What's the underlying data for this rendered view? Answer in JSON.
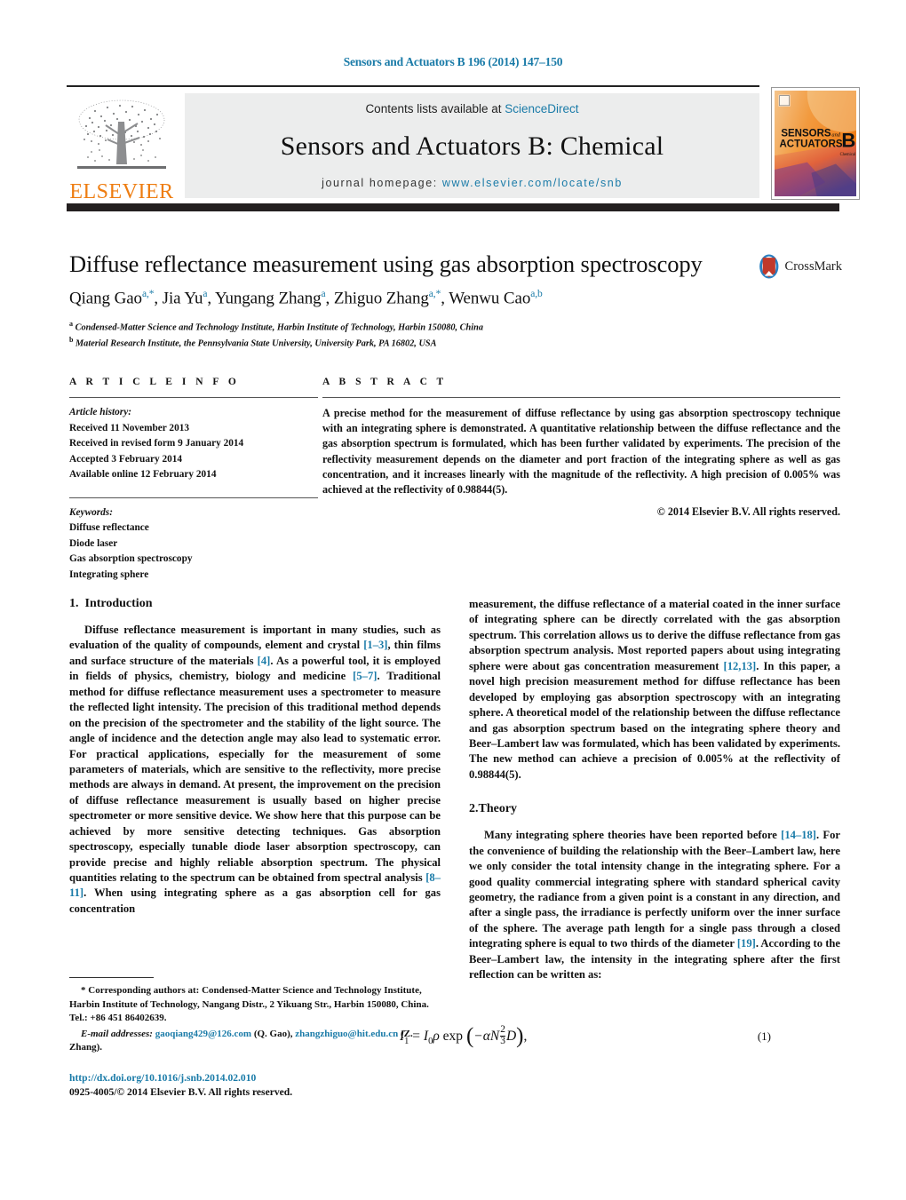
{
  "running_head": "Sensors and Actuators B 196 (2014) 147–150",
  "masthead": {
    "contents_prefix": "Contents lists available at ",
    "sciencedirect": "ScienceDirect",
    "journal_title": "Sensors and Actuators B: Chemical",
    "homepage_prefix": "journal homepage: ",
    "homepage_url": "www.elsevier.com/locate/snb",
    "publisher_wordmark": "ELSEVIER",
    "cover_line1": "SENSORS",
    "cover_and": "and",
    "cover_line2": "ACTUATORS",
    "cover_letter": "B",
    "cover_sub": "Chemical"
  },
  "article": {
    "title": "Diffuse reflectance measurement using gas absorption spectroscopy",
    "crossmark_label": "CrossMark",
    "authors_html": "Qiang Gao<sup>a,*</sup>, Jia Yu<sup>a</sup>, Yungang Zhang<sup>a</sup>, Zhiguo Zhang<sup>a,*</sup>, Wenwu Cao<sup>a,b</sup>",
    "affiliations": [
      "a Condensed-Matter Science and Technology Institute, Harbin Institute of Technology, Harbin 150080, China",
      "b Material Research Institute, the Pennsylvania State University, University Park, PA 16802, USA"
    ]
  },
  "article_info": {
    "heading": "A R T I C L E    I N F O",
    "history_label": "Article history:",
    "history": [
      "Received 11 November 2013",
      "Received in revised form 9 January 2014",
      "Accepted 3 February 2014",
      "Available online 12 February 2014"
    ],
    "keywords_label": "Keywords:",
    "keywords": [
      "Diffuse reflectance",
      "Diode laser",
      "Gas absorption spectroscopy",
      "Integrating sphere"
    ]
  },
  "abstract": {
    "heading": "A B S T R A C T",
    "text": "A precise method for the measurement of diffuse reflectance by using gas absorption spectroscopy technique with an integrating sphere is demonstrated. A quantitative relationship between the diffuse reflectance and the gas absorption spectrum is formulated, which has been further validated by experiments. The precision of the reflectivity measurement depends on the diameter and port fraction of the integrating sphere as well as gas concentration, and it increases linearly with the magnitude of the reflectivity. A high precision of 0.005% was achieved at the reflectivity of 0.98844(5).",
    "copyright": "© 2014 Elsevier B.V. All rights reserved."
  },
  "sections": {
    "intro": {
      "number": "1.",
      "title": "Introduction",
      "para_part1": "Diffuse reflectance measurement is important in many studies, such as evaluation of the quality of compounds, element and crystal ",
      "ref1": "[1–3]",
      "para_part2": ", thin films and surface structure of the materials ",
      "ref2": "[4]",
      "para_part3": ". As a powerful tool, it is employed in fields of physics, chemistry, biology and medicine ",
      "ref3": "[5–7]",
      "para_part4": ". Traditional method for diffuse reflectance measurement uses a spectrometer to measure the reflected light intensity. The precision of this traditional method depends on the precision of the spectrometer and the stability of the light source. The angle of incidence and the detection angle may also lead to systematic error. For practical applications, especially for the measurement of some parameters of materials, which are sensitive to the reflectivity, more precise methods are always in demand. At present, the improvement on the precision of diffuse reflectance measurement is usually based on higher precise spectrometer or more sensitive device. We show here that this purpose can be achieved by more sensitive detecting techniques. Gas absorption spectroscopy, especially tunable diode laser absorption spectroscopy, can provide precise and highly reliable absorption spectrum. The physical quantities relating to the spectrum can be obtained from spectral analysis ",
      "ref4": "[8–11]",
      "para_part5": ". When using integrating sphere as a gas absorption cell for gas concentration measurement, the diffuse reflectance of a material coated in the inner surface of integrating sphere can be directly correlated with the gas absorption spectrum. This correlation allows us to derive the diffuse reflectance from gas absorption spectrum analysis. Most reported papers about using integrating sphere were about gas concentration measurement ",
      "ref5": "[12,13]",
      "para_part6": ". In this paper, a novel high precision measurement method for diffuse reflectance has been developed by employing gas absorption spectroscopy with an integrating sphere. A theoretical model of the relationship between the diffuse reflectance and gas absorption spectrum based on the integrating sphere theory and Beer–Lambert law was formulated, which has been validated by experiments. The new method can achieve a precision of 0.005% at the reflectivity of 0.98844(5)."
    },
    "theory": {
      "number": "2.",
      "title": "Theory",
      "para_part1": "Many integrating sphere theories have been reported before ",
      "ref1": "[14–18]",
      "para_part2": ". For the convenience of building the relationship with the Beer–Lambert law, here we only consider the total intensity change in the integrating sphere. For a good quality commercial integrating sphere with standard spherical cavity geometry, the radiance from a given point is a constant in any direction, and after a single pass, the irradiance is perfectly uniform over the inner surface of the sphere. The average path length for a single pass through a closed integrating sphere is equal to two thirds of the diameter ",
      "ref2": "[19]",
      "para_part3": ". According to the Beer–Lambert law, the intensity in the integrating sphere after the first reflection can be written as:"
    }
  },
  "equation": {
    "lhs_I": "I",
    "lhs_sub": "1",
    "eq_sign": "=",
    "rhs_I": "I",
    "rhs_sub": "0",
    "rho": "ρ",
    "exp": "exp",
    "minus_alpha_N": "−αN",
    "frac_num": "2",
    "frac_den": "3",
    "D": "D",
    "trailing_comma": ",",
    "number": "(1)"
  },
  "footnote": {
    "star": "*",
    "corresponding": " Corresponding authors at: Condensed-Matter Science and Technology Institute, Harbin Institute of Technology, Nangang Distr., 2 Yikuang Str., Harbin 150080, China. Tel.: +86 451 86402639.",
    "email_label": "E-mail addresses:",
    "email1": "gaoqiang429@126.com",
    "email1_owner": " (Q. Gao), ",
    "email2": "zhangzhiguo@hit.edu.cn",
    "email2_owner": " (Z. Zhang)."
  },
  "footer": {
    "doi": "http://dx.doi.org/10.1016/j.snb.2014.02.010",
    "issn": "0925-4005/© 2014 Elsevier B.V. All rights reserved."
  },
  "colors": {
    "link_blue": "#1a7ba8",
    "elsevier_orange": "#ee7d11",
    "rule_dark": "#231f20",
    "masthead_gray": "#eceded"
  }
}
